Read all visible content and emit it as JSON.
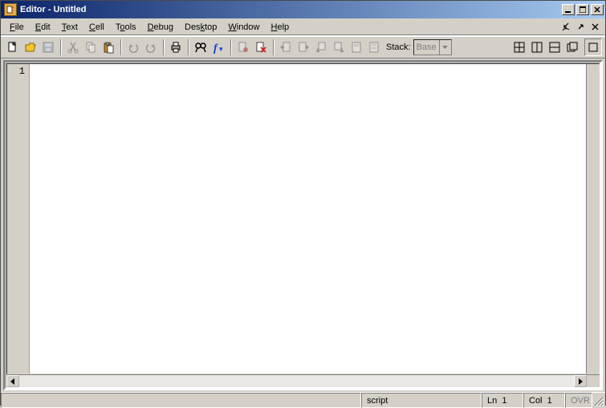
{
  "title": "Editor - Untitled",
  "menu": {
    "file": "File",
    "edit": "Edit",
    "text": "Text",
    "cell": "Cell",
    "tools": "Tools",
    "debug": "Debug",
    "desktop": "Desktop",
    "window": "Window",
    "help": "Help"
  },
  "toolbar": {
    "stack_label": "Stack:",
    "stack_value": "Base"
  },
  "gutter_line": "1",
  "status": {
    "mode": "script",
    "ln_label": "Ln",
    "ln_value": "1",
    "col_label": "Col",
    "col_value": "1",
    "ovr": "OVR"
  }
}
